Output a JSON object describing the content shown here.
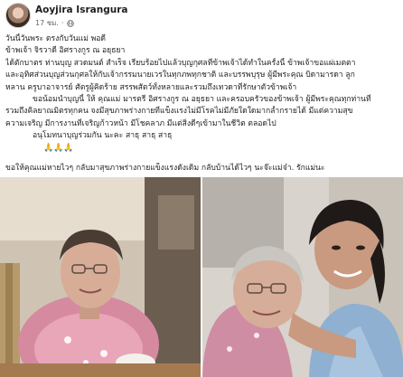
{
  "post": {
    "author": "Aoyjira Israngura",
    "timestamp": "17 ชม.",
    "separator": "·",
    "privacy_icon": "globe-icon"
  },
  "text": {
    "lines": [
      "วันนี้วันพระ ตรงกับวันแม่ พอดี",
      "ข้าพเจ้า จิรวาดี อิศรางกูร ณ อยุธยา",
      "ได้ตักบาตร ท่านบุญ สวดมนต์ สำเร็จ เรียบร้อยไปแล้วบุญกุศลที่ข้าพเจ้าได้ทำในครั้งนี้ ข้าพเจ้าขอแผ่เมตตา",
      "และอุทิศส่วนบุญส่วนกุศลให้กับเจ้ากรรมนายเวรในทุกภพทุกชาติ และบรรพบุรุษ ผู้มีพระคุณ บิดามารดา ลูก",
      "หลาน ครูบาอาจารย์ ศัตรูผู้คิดร้าย สรรพสัตว์ทั้งหลายและรวมถึงเทวดาที่รักษาตัวข้าพเจ้า",
      "ขอน้อมนำบุญนี้ ให้ คุณแม่ มารตรี อิศรางกูร ณ อยุธยา และครอบครัวของข้าพเจ้า ผู้มีพระคุณทุกท่านที่",
      "รวมถึงคิลยาณมิตรทุกคน จงมีสุขภาพร่างกายที่แข็งแรงไม่มีโรคไม่มีภัยใดใดมากล้ำกรายได้ มีแต่ความสุข",
      "ความเจริญ มีการงานที่เจริญก้าวหน้า มีโชคลาภ มีแต่สิ่งดีๆเข้ามาในชีวิต ตลอดไป",
      "อนุโมทนาบุญร่วมกัน นะคะ สาธุ สาธุ สาธุ",
      "🙏🙏🙏",
      "ขอให้คุณแม่หายไวๆ กลับมาสุขภาพร่างกายแข็งแรงดังเดิม กลับบ้านได้ไวๆ นะจ๊ะแม่จ๋า. รักแม่นะ"
    ]
  },
  "photos": [
    {
      "alt": "elderly-woman-seated-at-table"
    },
    {
      "alt": "author-hugging-elderly-woman"
    }
  ],
  "colors": {
    "text": "#1c1e21",
    "meta": "#65676b",
    "background": "#ffffff"
  }
}
